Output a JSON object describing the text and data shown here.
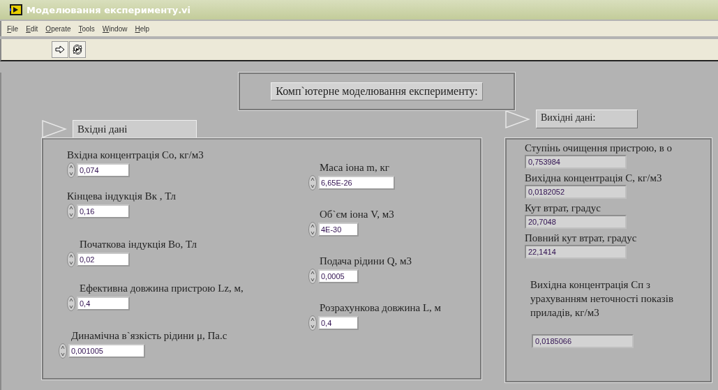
{
  "window": {
    "title": "Моделювання експерименту.vi"
  },
  "menu": [
    {
      "label": "File"
    },
    {
      "label": "Edit"
    },
    {
      "label": "Operate"
    },
    {
      "label": "Tools"
    },
    {
      "label": "Window"
    },
    {
      "label": "Help"
    }
  ],
  "heading": "Комп`ютерне моделювання експерименту:",
  "inputs": {
    "tab_label": "Вхідні дані",
    "column_1": [
      {
        "label": "Вхідна концентрація Со, кг/м3",
        "value": "0,074"
      },
      {
        "label": "Кінцева індукція Вк , Тл",
        "value": "0,16"
      },
      {
        "label": "Початкова індукція Во, Тл",
        "value": "0,02"
      },
      {
        "label": "Ефективна довжина пристрою Lz, м,",
        "value": "0,4"
      },
      {
        "label": "Динамічна в`язкість рідини μ, Па.с",
        "value": "0,001005"
      }
    ],
    "column_2": [
      {
        "label": "Маса іона m, кг",
        "value": "6,65E-26"
      },
      {
        "label": "Об`єм іона V, м3",
        "value": "4E-30"
      },
      {
        "label": "Подача рідини Q, м3",
        "value": "0,0005"
      },
      {
        "label": "Розрахункова довжина L, м",
        "value": "0,4"
      }
    ]
  },
  "outputs": {
    "tab_label": "Вихідні дані:",
    "indicators": [
      {
        "label": "Ступінь очищення пристрою, в о",
        "value": "0,753984"
      },
      {
        "label": "Вихідна концентрація С, кг/м3",
        "value": "0,0182052"
      },
      {
        "label": "Кут втрат, градус",
        "value": "20,7048"
      },
      {
        "label": "Повний кут втрат, градус",
        "value": "22,1414"
      },
      {
        "label": "Вихідна концентрація Сп з урахуванням неточності показів приладів, кг/м3",
        "value": "0,0185066"
      }
    ]
  }
}
